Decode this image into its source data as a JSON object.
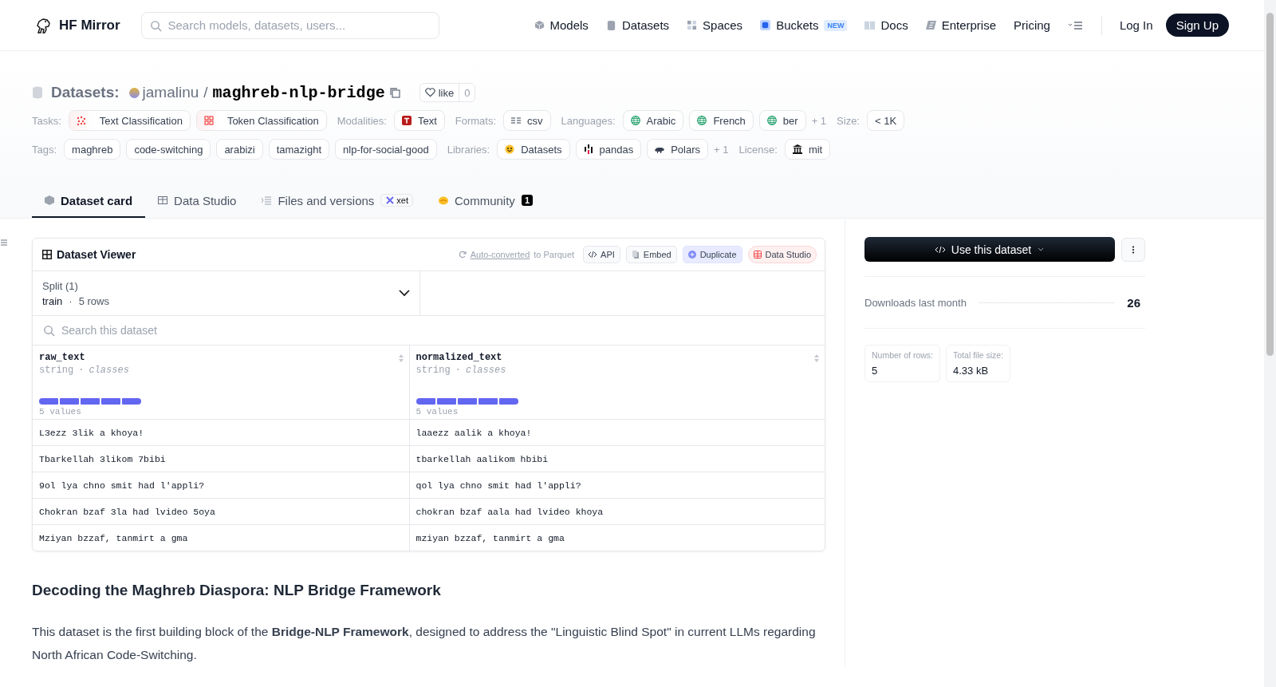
{
  "header": {
    "logo_text": "HF Mirror",
    "search": {
      "placeholder": "Search models, datasets, users..."
    },
    "nav": [
      {
        "label": "Models",
        "kind": "models"
      },
      {
        "label": "Datasets",
        "kind": "datasets"
      },
      {
        "label": "Spaces",
        "kind": "spaces"
      },
      {
        "label": "Buckets",
        "kind": "buckets",
        "badge": "NEW"
      },
      {
        "label": "Docs",
        "kind": "docs"
      },
      {
        "label": "Enterprise",
        "kind": "enterprise"
      },
      {
        "label": "Pricing",
        "kind": "plain"
      }
    ],
    "log_in": "Log In",
    "sign_up": "Sign Up"
  },
  "repo": {
    "prefix": "Datasets:",
    "owner": "jamalinu",
    "separator": "/",
    "name": "maghreb-nlp-bridge",
    "like": "like",
    "like_count": "0"
  },
  "meta_rows": [
    [
      {
        "label": "Tasks:",
        "chips": [
          {
            "text": "Text Classification",
            "kind": "textcls"
          },
          {
            "text": "Token Classification",
            "kind": "tokencls"
          }
        ]
      },
      {
        "label": "Modalities:",
        "chips": [
          {
            "text": "Text",
            "kind": "text"
          }
        ]
      },
      {
        "label": "Formats:",
        "chips": [
          {
            "text": "csv",
            "kind": "csv"
          }
        ]
      },
      {
        "label": "Languages:",
        "chips": [
          {
            "text": "Arabic",
            "kind": "globe"
          },
          {
            "text": "French",
            "kind": "globe"
          },
          {
            "text": "ber",
            "kind": "globe"
          }
        ],
        "more": "+ 1"
      },
      {
        "label": "Size:",
        "chips": [
          {
            "text": "< 1K",
            "kind": "plain"
          }
        ]
      }
    ],
    [
      {
        "label": "Tags:",
        "chips": [
          {
            "text": "maghreb",
            "kind": "plain"
          },
          {
            "text": "code-switching",
            "kind": "plain"
          },
          {
            "text": "arabizi",
            "kind": "plain"
          },
          {
            "text": "tamazight",
            "kind": "plain"
          },
          {
            "text": "nlp-for-social-good",
            "kind": "plain"
          }
        ]
      },
      {
        "label": "Libraries:",
        "chips": [
          {
            "text": "Datasets",
            "kind": "hf"
          },
          {
            "text": "pandas",
            "kind": "pandas"
          },
          {
            "text": "Polars",
            "kind": "polars"
          }
        ],
        "more": "+ 1"
      },
      {
        "label": "License:",
        "chips": [
          {
            "text": "mit",
            "kind": "license"
          }
        ]
      }
    ]
  ],
  "tabs": [
    {
      "label": "Dataset card",
      "kind": "card",
      "selected": true
    },
    {
      "label": "Data Studio",
      "kind": "studio",
      "selected": false
    },
    {
      "label": "Files and versions",
      "kind": "files",
      "selected": false,
      "badge": "xet"
    },
    {
      "label": "Community",
      "kind": "community",
      "selected": false,
      "count": "1"
    }
  ],
  "viewer": {
    "title": "Dataset Viewer",
    "converted_link": "Auto-converted",
    "converted_rest": "to Parquet",
    "buttons": [
      {
        "label": "API",
        "kind": "api"
      },
      {
        "label": "Embed",
        "kind": "embed"
      },
      {
        "label": "Duplicate",
        "kind": "duplicate"
      },
      {
        "label": "Data Studio",
        "kind": "studio"
      }
    ],
    "split": {
      "label": "Split (1)",
      "name": "train",
      "separator": "·",
      "rows": "5 rows"
    },
    "search": {
      "placeholder": "Search this dataset"
    },
    "columns": [
      {
        "name": "raw_text",
        "type": "string",
        "separator": "·",
        "subtype": "classes",
        "values": "5 values"
      },
      {
        "name": "normalized_text",
        "type": "string",
        "separator": "·",
        "subtype": "classes",
        "values": "5 values"
      }
    ],
    "rows": [
      [
        "L3ezz 3lik a khoya!",
        "laaezz aalik a khoya!"
      ],
      [
        "Tbarkellah 3likom 7bibi",
        "tbarkellah aalikom hbibi"
      ],
      [
        "9ol lya chno smit had l'appli?",
        "qol lya chno smit had l'appli?"
      ],
      [
        "Chokran bzaf 3la had lvideo 5oya",
        "chokran bzaf aala had lvideo khoya"
      ],
      [
        "Mziyan bzzaf, tanmirt a gma",
        "mziyan bzzaf, tanmirt a gma"
      ]
    ]
  },
  "sidebar": {
    "use_button": "Use this dataset",
    "downloads_label": "Downloads last month",
    "downloads": "26",
    "stats": [
      {
        "label": "Number of rows:",
        "value": "5"
      },
      {
        "label": "Total file size:",
        "value": "4.33 kB"
      }
    ]
  },
  "article": {
    "heading": "Decoding the Maghreb Diaspora: NLP Bridge Framework",
    "paragraph": "This dataset is the first building block of the **Bridge-NLP Framework**, designed to address the \"Linguistic Blind Spot\" in current LLMs regarding North African Code-Switching."
  }
}
